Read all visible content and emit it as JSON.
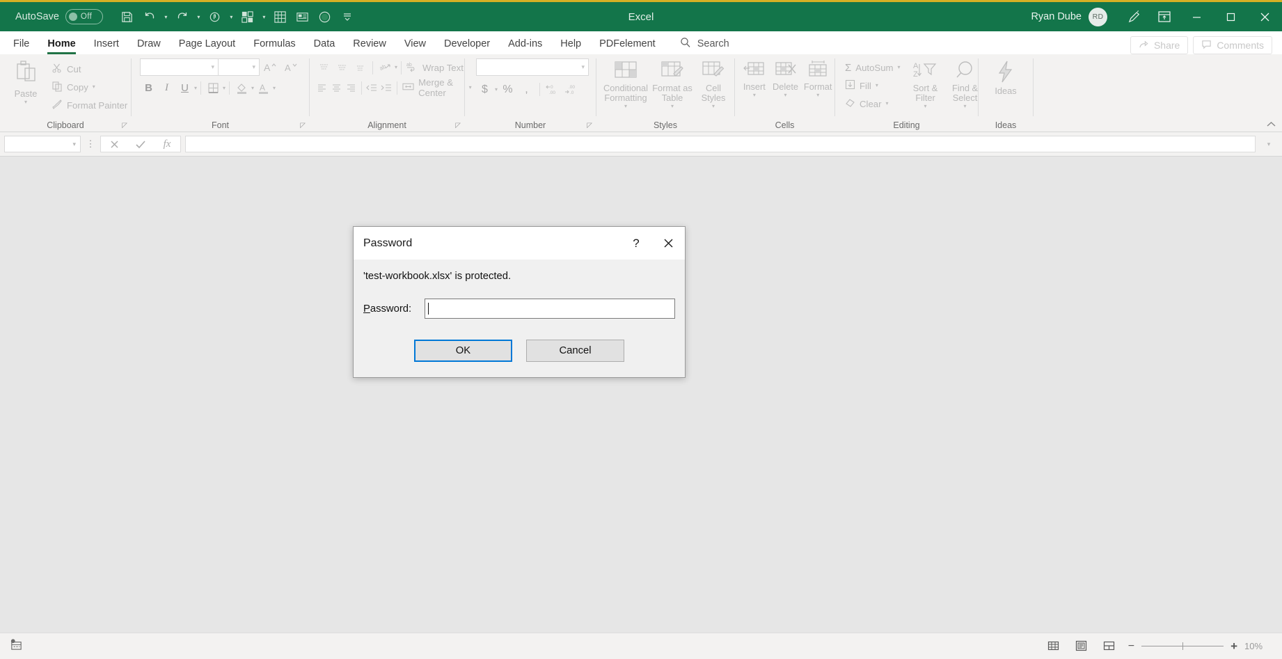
{
  "titlebar": {
    "autosave_label": "AutoSave",
    "autosave_state": "Off",
    "app_title": "Excel",
    "user_name": "Ryan Dube",
    "user_initials": "RD",
    "quick_access": [
      {
        "name": "save-icon",
        "label": "Save"
      },
      {
        "name": "undo-icon",
        "label": "Undo"
      },
      {
        "name": "redo-icon",
        "label": "Redo"
      },
      {
        "name": "touch-mode-icon",
        "label": "Touch/Mouse Mode"
      },
      {
        "name": "pivot-icon",
        "label": "PivotTable"
      },
      {
        "name": "table-icon",
        "label": "Table"
      },
      {
        "name": "card-icon",
        "label": "Form"
      },
      {
        "name": "record-icon",
        "label": "Record Macro"
      },
      {
        "name": "customize-qat-icon",
        "label": "Customize Quick Access Toolbar"
      }
    ],
    "window_buttons": [
      {
        "name": "pen-icon",
        "label": "Ink"
      },
      {
        "name": "ribbon-display-icon",
        "label": "Ribbon Display Options"
      },
      {
        "name": "minimize-icon",
        "label": "Minimize"
      },
      {
        "name": "maximize-icon",
        "label": "Maximize"
      },
      {
        "name": "close-icon",
        "label": "Close"
      }
    ],
    "colors": {
      "bar": "#13754a",
      "accent_top": "#d6b024"
    }
  },
  "tabs": [
    {
      "label": "File",
      "active": false
    },
    {
      "label": "Home",
      "active": true
    },
    {
      "label": "Insert",
      "active": false
    },
    {
      "label": "Draw",
      "active": false
    },
    {
      "label": "Page Layout",
      "active": false
    },
    {
      "label": "Formulas",
      "active": false
    },
    {
      "label": "Data",
      "active": false
    },
    {
      "label": "Review",
      "active": false
    },
    {
      "label": "View",
      "active": false
    },
    {
      "label": "Developer",
      "active": false
    },
    {
      "label": "Add-ins",
      "active": false
    },
    {
      "label": "Help",
      "active": false
    },
    {
      "label": "PDFelement",
      "active": false
    }
  ],
  "search": {
    "label": "Search",
    "icon": "search-icon"
  },
  "tabrow_right": [
    {
      "label": "Share",
      "icon": "share-icon"
    },
    {
      "label": "Comments",
      "icon": "comment-icon"
    }
  ],
  "ribbon": {
    "collapse_icon": "chevron-up-icon",
    "groups": [
      {
        "name": "clipboard",
        "label": "Clipboard",
        "has_launcher": true,
        "paste_label": "Paste",
        "items": [
          {
            "label": "Cut",
            "icon": "scissors-icon"
          },
          {
            "label": "Copy",
            "icon": "copy-icon",
            "caret": true
          },
          {
            "label": "Format Painter",
            "icon": "paintbrush-icon"
          }
        ]
      },
      {
        "name": "font",
        "label": "Font",
        "has_launcher": true,
        "font_name_value": "",
        "font_size_value": "",
        "grow_label": "A",
        "shrink_label": "A",
        "items": [
          {
            "label": "B",
            "icon": "bold-icon"
          },
          {
            "label": "I",
            "icon": "italic-icon"
          },
          {
            "label": "U",
            "icon": "underline-icon"
          },
          {
            "label": "",
            "icon": "borders-icon"
          },
          {
            "label": "",
            "icon": "fill-color-icon"
          },
          {
            "label": "A",
            "icon": "font-color-icon"
          }
        ]
      },
      {
        "name": "alignment",
        "label": "Alignment",
        "has_launcher": true,
        "wrap_text_label": "Wrap Text",
        "merge_label": "Merge & Center"
      },
      {
        "name": "number",
        "label": "Number",
        "has_launcher": true,
        "format_value": "",
        "symbols": [
          "$",
          "%",
          ","
        ],
        "decimals": [
          "increase-decimal-icon",
          "decrease-decimal-icon"
        ]
      },
      {
        "name": "styles",
        "label": "Styles",
        "has_launcher": false,
        "items": [
          {
            "label": "Conditional Formatting",
            "icon": "conditional-formatting-icon",
            "caret": true
          },
          {
            "label": "Format as Table",
            "icon": "format-as-table-icon",
            "caret": true
          },
          {
            "label": "Cell Styles",
            "icon": "cell-styles-icon",
            "caret": true
          }
        ]
      },
      {
        "name": "cells",
        "label": "Cells",
        "has_launcher": false,
        "items": [
          {
            "label": "Insert",
            "icon": "insert-cells-icon",
            "caret": true
          },
          {
            "label": "Delete",
            "icon": "delete-cells-icon",
            "caret": true
          },
          {
            "label": "Format",
            "icon": "format-cells-icon",
            "caret": true
          }
        ]
      },
      {
        "name": "editing",
        "label": "Editing",
        "has_launcher": false,
        "small_items": [
          {
            "label": "AutoSum",
            "icon": "sigma-icon",
            "caret": true
          },
          {
            "label": "Fill",
            "icon": "fill-down-icon",
            "caret": true
          },
          {
            "label": "Clear",
            "icon": "eraser-icon",
            "caret": true
          }
        ],
        "big_items": [
          {
            "label": "Sort & Filter",
            "icon": "sort-filter-icon",
            "caret": true
          },
          {
            "label": "Find & Select",
            "icon": "magnifier-icon",
            "caret": true
          }
        ]
      },
      {
        "name": "ideas",
        "label": "Ideas",
        "has_launcher": false,
        "items": [
          {
            "label": "Ideas",
            "icon": "lightning-icon"
          }
        ]
      }
    ]
  },
  "formulabar": {
    "namebox_value": "",
    "cancel_icon": "cancel-icon",
    "enter_icon": "check-icon",
    "function_icon": "fx-icon",
    "formula_value": "",
    "expand_icon": "chevron-down-icon"
  },
  "statusbar": {
    "macro_icon": "record-macro-icon",
    "view_buttons": [
      {
        "name": "normal-view-icon",
        "label": "Normal"
      },
      {
        "name": "page-layout-view-icon",
        "label": "Page Layout"
      },
      {
        "name": "page-break-view-icon",
        "label": "Page Break Preview"
      }
    ],
    "zoom_out_label": "−",
    "zoom_in_label": "+",
    "zoom_value": "10%"
  },
  "dialog": {
    "title": "Password",
    "help_label": "?",
    "close_icon": "close-icon",
    "message": "'test-workbook.xlsx' is protected.",
    "field_label_prefix": "P",
    "field_label_rest": "assword:",
    "password_value": "",
    "ok_label": "OK",
    "cancel_label": "Cancel"
  }
}
